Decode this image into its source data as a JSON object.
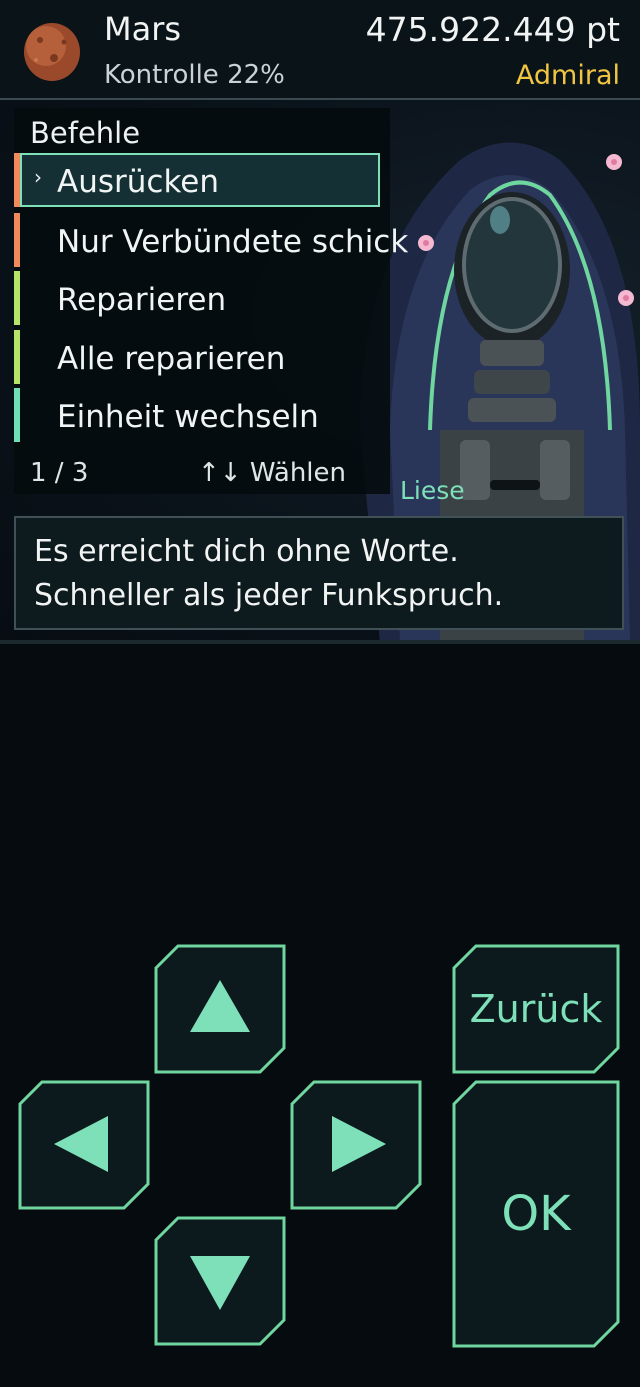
{
  "header": {
    "planet_name": "Mars",
    "control": "Kontrolle 22%",
    "points": "475.922.449 pt",
    "rank": "Admiral",
    "planet_icon": "planet-mars-icon"
  },
  "menu": {
    "title": "Befehle",
    "items": [
      {
        "label": "Ausrücken",
        "color": "#f08a5d",
        "selected": true
      },
      {
        "label": "Nur Verbündete schick",
        "color": "#f08a5d",
        "selected": false
      },
      {
        "label": "Reparieren",
        "color": "#b6e36a",
        "selected": false
      },
      {
        "label": "Alle reparieren",
        "color": "#b6e36a",
        "selected": false
      },
      {
        "label": "Einheit wechseln",
        "color": "#6fe0b5",
        "selected": false
      }
    ],
    "page": "1 / 3",
    "hint": "↑↓ Wählen"
  },
  "dialog": {
    "speaker": "Liese",
    "line1": "Es erreicht dich ohne Worte.",
    "line2": "Schneller als jeder Funkspruch."
  },
  "controls": {
    "up": "up-arrow-icon",
    "down": "down-arrow-icon",
    "left": "left-arrow-icon",
    "right": "right-arrow-icon",
    "back_label": "Zurück",
    "ok_label": "OK"
  },
  "colors": {
    "accent": "#7de0b8",
    "rank": "#f0c541",
    "background": "#050b0e"
  }
}
